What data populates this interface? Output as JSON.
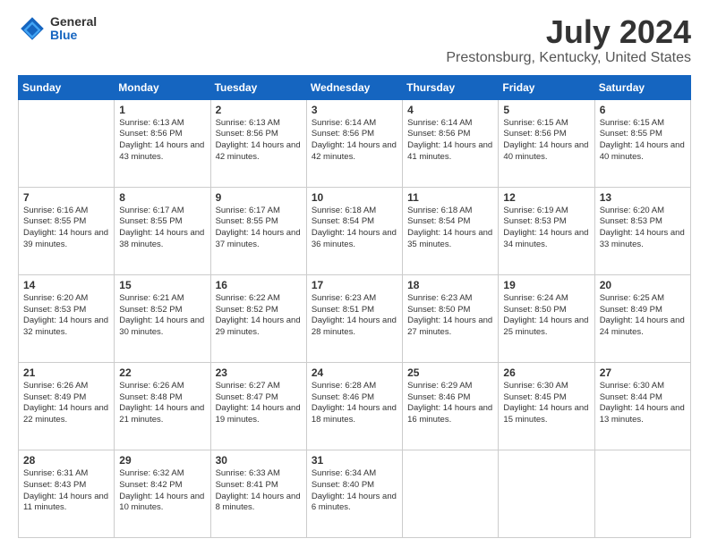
{
  "logo": {
    "general": "General",
    "blue": "Blue"
  },
  "header": {
    "title": "July 2024",
    "subtitle": "Prestonsburg, Kentucky, United States"
  },
  "days": [
    "Sunday",
    "Monday",
    "Tuesday",
    "Wednesday",
    "Thursday",
    "Friday",
    "Saturday"
  ],
  "weeks": [
    [
      {
        "day": "",
        "sunrise": "",
        "sunset": "",
        "daylight": ""
      },
      {
        "day": "1",
        "sunrise": "Sunrise: 6:13 AM",
        "sunset": "Sunset: 8:56 PM",
        "daylight": "Daylight: 14 hours and 43 minutes."
      },
      {
        "day": "2",
        "sunrise": "Sunrise: 6:13 AM",
        "sunset": "Sunset: 8:56 PM",
        "daylight": "Daylight: 14 hours and 42 minutes."
      },
      {
        "day": "3",
        "sunrise": "Sunrise: 6:14 AM",
        "sunset": "Sunset: 8:56 PM",
        "daylight": "Daylight: 14 hours and 42 minutes."
      },
      {
        "day": "4",
        "sunrise": "Sunrise: 6:14 AM",
        "sunset": "Sunset: 8:56 PM",
        "daylight": "Daylight: 14 hours and 41 minutes."
      },
      {
        "day": "5",
        "sunrise": "Sunrise: 6:15 AM",
        "sunset": "Sunset: 8:56 PM",
        "daylight": "Daylight: 14 hours and 40 minutes."
      },
      {
        "day": "6",
        "sunrise": "Sunrise: 6:15 AM",
        "sunset": "Sunset: 8:55 PM",
        "daylight": "Daylight: 14 hours and 40 minutes."
      }
    ],
    [
      {
        "day": "7",
        "sunrise": "Sunrise: 6:16 AM",
        "sunset": "Sunset: 8:55 PM",
        "daylight": "Daylight: 14 hours and 39 minutes."
      },
      {
        "day": "8",
        "sunrise": "Sunrise: 6:17 AM",
        "sunset": "Sunset: 8:55 PM",
        "daylight": "Daylight: 14 hours and 38 minutes."
      },
      {
        "day": "9",
        "sunrise": "Sunrise: 6:17 AM",
        "sunset": "Sunset: 8:55 PM",
        "daylight": "Daylight: 14 hours and 37 minutes."
      },
      {
        "day": "10",
        "sunrise": "Sunrise: 6:18 AM",
        "sunset": "Sunset: 8:54 PM",
        "daylight": "Daylight: 14 hours and 36 minutes."
      },
      {
        "day": "11",
        "sunrise": "Sunrise: 6:18 AM",
        "sunset": "Sunset: 8:54 PM",
        "daylight": "Daylight: 14 hours and 35 minutes."
      },
      {
        "day": "12",
        "sunrise": "Sunrise: 6:19 AM",
        "sunset": "Sunset: 8:53 PM",
        "daylight": "Daylight: 14 hours and 34 minutes."
      },
      {
        "day": "13",
        "sunrise": "Sunrise: 6:20 AM",
        "sunset": "Sunset: 8:53 PM",
        "daylight": "Daylight: 14 hours and 33 minutes."
      }
    ],
    [
      {
        "day": "14",
        "sunrise": "Sunrise: 6:20 AM",
        "sunset": "Sunset: 8:53 PM",
        "daylight": "Daylight: 14 hours and 32 minutes."
      },
      {
        "day": "15",
        "sunrise": "Sunrise: 6:21 AM",
        "sunset": "Sunset: 8:52 PM",
        "daylight": "Daylight: 14 hours and 30 minutes."
      },
      {
        "day": "16",
        "sunrise": "Sunrise: 6:22 AM",
        "sunset": "Sunset: 8:52 PM",
        "daylight": "Daylight: 14 hours and 29 minutes."
      },
      {
        "day": "17",
        "sunrise": "Sunrise: 6:23 AM",
        "sunset": "Sunset: 8:51 PM",
        "daylight": "Daylight: 14 hours and 28 minutes."
      },
      {
        "day": "18",
        "sunrise": "Sunrise: 6:23 AM",
        "sunset": "Sunset: 8:50 PM",
        "daylight": "Daylight: 14 hours and 27 minutes."
      },
      {
        "day": "19",
        "sunrise": "Sunrise: 6:24 AM",
        "sunset": "Sunset: 8:50 PM",
        "daylight": "Daylight: 14 hours and 25 minutes."
      },
      {
        "day": "20",
        "sunrise": "Sunrise: 6:25 AM",
        "sunset": "Sunset: 8:49 PM",
        "daylight": "Daylight: 14 hours and 24 minutes."
      }
    ],
    [
      {
        "day": "21",
        "sunrise": "Sunrise: 6:26 AM",
        "sunset": "Sunset: 8:49 PM",
        "daylight": "Daylight: 14 hours and 22 minutes."
      },
      {
        "day": "22",
        "sunrise": "Sunrise: 6:26 AM",
        "sunset": "Sunset: 8:48 PM",
        "daylight": "Daylight: 14 hours and 21 minutes."
      },
      {
        "day": "23",
        "sunrise": "Sunrise: 6:27 AM",
        "sunset": "Sunset: 8:47 PM",
        "daylight": "Daylight: 14 hours and 19 minutes."
      },
      {
        "day": "24",
        "sunrise": "Sunrise: 6:28 AM",
        "sunset": "Sunset: 8:46 PM",
        "daylight": "Daylight: 14 hours and 18 minutes."
      },
      {
        "day": "25",
        "sunrise": "Sunrise: 6:29 AM",
        "sunset": "Sunset: 8:46 PM",
        "daylight": "Daylight: 14 hours and 16 minutes."
      },
      {
        "day": "26",
        "sunrise": "Sunrise: 6:30 AM",
        "sunset": "Sunset: 8:45 PM",
        "daylight": "Daylight: 14 hours and 15 minutes."
      },
      {
        "day": "27",
        "sunrise": "Sunrise: 6:30 AM",
        "sunset": "Sunset: 8:44 PM",
        "daylight": "Daylight: 14 hours and 13 minutes."
      }
    ],
    [
      {
        "day": "28",
        "sunrise": "Sunrise: 6:31 AM",
        "sunset": "Sunset: 8:43 PM",
        "daylight": "Daylight: 14 hours and 11 minutes."
      },
      {
        "day": "29",
        "sunrise": "Sunrise: 6:32 AM",
        "sunset": "Sunset: 8:42 PM",
        "daylight": "Daylight: 14 hours and 10 minutes."
      },
      {
        "day": "30",
        "sunrise": "Sunrise: 6:33 AM",
        "sunset": "Sunset: 8:41 PM",
        "daylight": "Daylight: 14 hours and 8 minutes."
      },
      {
        "day": "31",
        "sunrise": "Sunrise: 6:34 AM",
        "sunset": "Sunset: 8:40 PM",
        "daylight": "Daylight: 14 hours and 6 minutes."
      },
      {
        "day": "",
        "sunrise": "",
        "sunset": "",
        "daylight": ""
      },
      {
        "day": "",
        "sunrise": "",
        "sunset": "",
        "daylight": ""
      },
      {
        "day": "",
        "sunrise": "",
        "sunset": "",
        "daylight": ""
      }
    ]
  ]
}
